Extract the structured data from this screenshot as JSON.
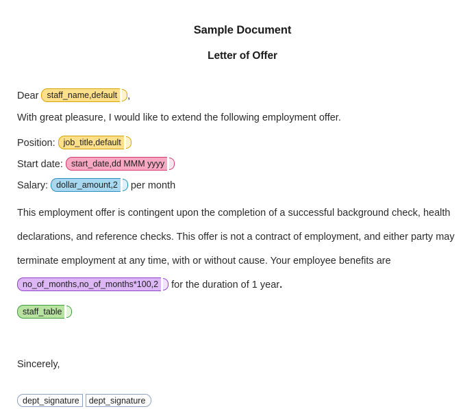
{
  "document": {
    "title": "Sample Document",
    "subtitle": "Letter of Offer"
  },
  "salutation": {
    "prefix": "Dear ",
    "field": "staff_name,default",
    "suffix": ","
  },
  "intro": "With great pleasure, I would like to extend the following employment offer.",
  "details": [
    {
      "label": "Position: ",
      "field": "job_title,default",
      "after": "",
      "color": "yellow"
    },
    {
      "label": "Start date: ",
      "field": "start_date,dd MMM yyyy",
      "after": "",
      "color": "pink"
    },
    {
      "label": "Salary: ",
      "field": "dollar_amount,2",
      "after": " per month",
      "color": "blue"
    }
  ],
  "terms": {
    "text_before": "This employment offer is contingent upon the completion of a successful background check, health declarations, and reference checks. This offer is not a contract of employment, and either party may terminate employment at any time, with or without cause. Your employee benefits are ",
    "field": "no_of_months,no_of_months*100,2",
    "text_after": " for the duration of 1 year",
    "period": "."
  },
  "table_field": {
    "field": "staff_table",
    "color": "green"
  },
  "closing": {
    "sincerely": "Sincerely,",
    "signature_open": "dept_signature",
    "signature_close": "dept_signature"
  },
  "colors": {
    "yellow_fill": "#ffe08a",
    "yellow_border": "#d8a400",
    "pink_fill": "#f9a8c4",
    "pink_border": "#d63a70",
    "blue_fill": "#a8d8ef",
    "blue_border": "#2a8fc0",
    "purple_fill": "#dcb6f5",
    "purple_border": "#9143c9",
    "green_fill": "#b7e2a0",
    "green_border": "#3f9f3f",
    "signature_border": "#8da0c4",
    "text": "#2b2b2b",
    "background": "#ffffff"
  }
}
